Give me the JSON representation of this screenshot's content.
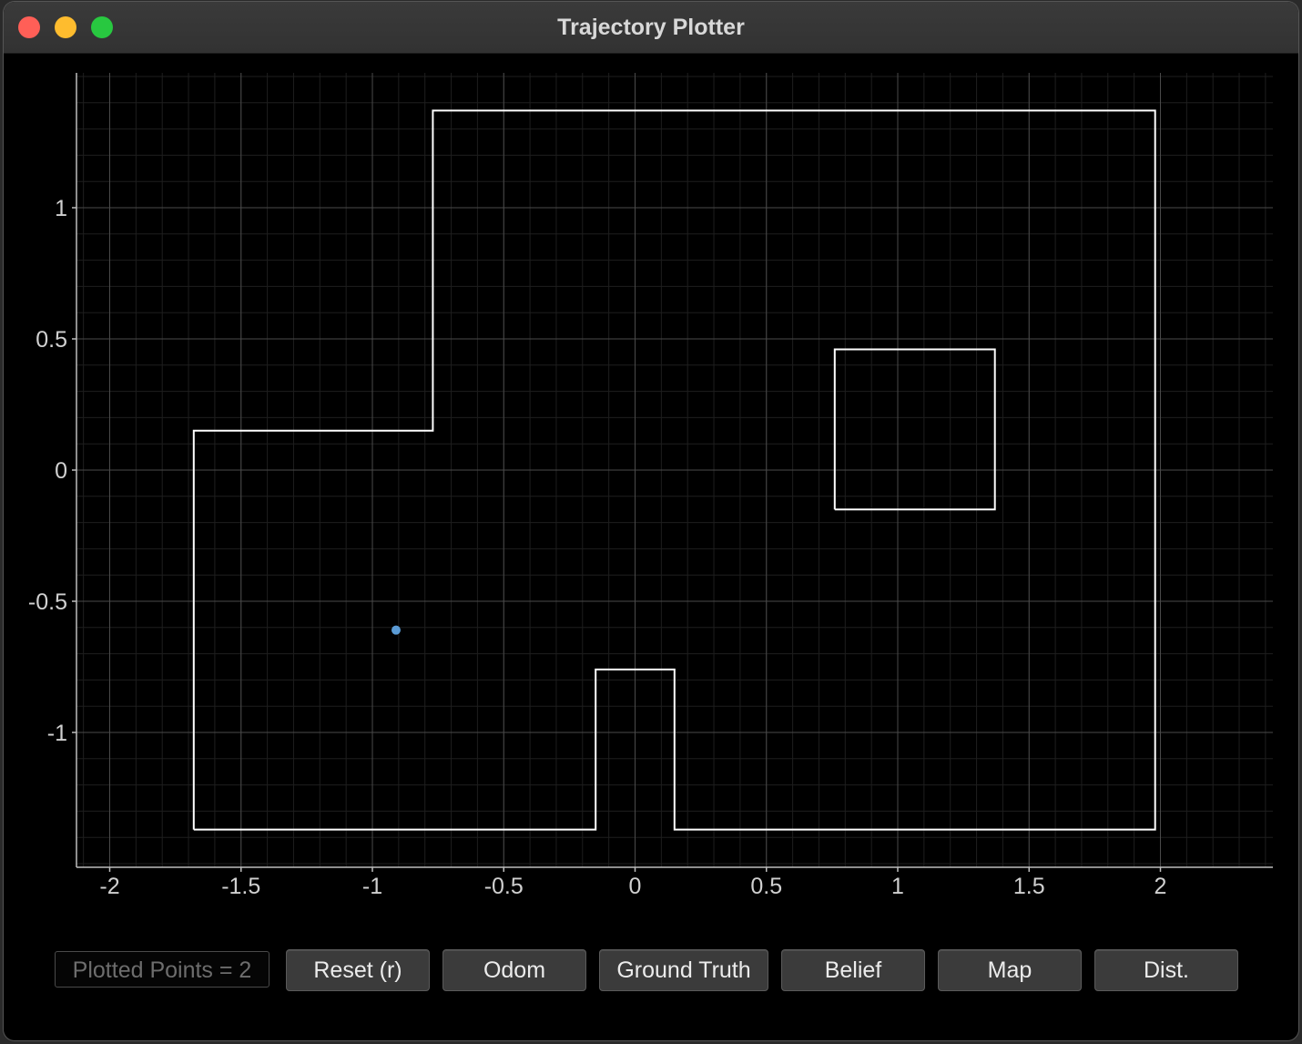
{
  "window": {
    "title": "Trajectory Plotter"
  },
  "chart_data": {
    "type": "scatter",
    "title": "",
    "xlabel": "",
    "ylabel": "",
    "xlim": [
      -2.13,
      2.43
    ],
    "ylim": [
      -1.52,
      1.52
    ],
    "grid": true,
    "x_ticks": [
      -2,
      -1.5,
      -1,
      -0.5,
      0,
      0.5,
      1,
      1.5,
      2
    ],
    "y_ticks": [
      1,
      0.5,
      0,
      -0.5,
      -1
    ],
    "x_tick_labels": [
      "-2",
      "-1.5",
      "-1",
      "-0.5",
      "0",
      "0.5",
      "1",
      "1.5",
      "2"
    ],
    "y_tick_labels": [
      "1",
      "0.5",
      "0",
      "-0.5",
      "-1"
    ],
    "map_outline": [
      [
        -1.68,
        -1.37
      ],
      [
        -1.68,
        0.15
      ],
      [
        -0.77,
        0.15
      ],
      [
        -0.77,
        1.37
      ],
      [
        1.98,
        1.37
      ],
      [
        1.98,
        -1.37
      ],
      [
        0.15,
        -1.37
      ],
      [
        0.15,
        -0.76
      ],
      [
        -0.15,
        -0.76
      ],
      [
        -0.15,
        -1.37
      ],
      [
        -1.68,
        -1.37
      ]
    ],
    "map_obstacle": [
      [
        0.76,
        -0.15
      ],
      [
        1.37,
        -0.15
      ],
      [
        1.37,
        0.46
      ],
      [
        0.76,
        0.46
      ],
      [
        0.76,
        -0.15
      ]
    ],
    "series": [
      {
        "color": "#5b9bd5",
        "points": [
          [
            -0.91,
            -0.61
          ]
        ]
      }
    ],
    "colors": {
      "background": "#000000",
      "major_grid": "#4a4a4a",
      "minor_grid": "#1e1e1e",
      "map_line": "#ffffff",
      "axis": "#bdbdbd"
    }
  },
  "controls": {
    "plotted_points": "Plotted Points = 2",
    "reset": "Reset (r)",
    "odom": "Odom",
    "ground_truth": "Ground Truth",
    "belief": "Belief",
    "map": "Map",
    "dist": "Dist."
  }
}
